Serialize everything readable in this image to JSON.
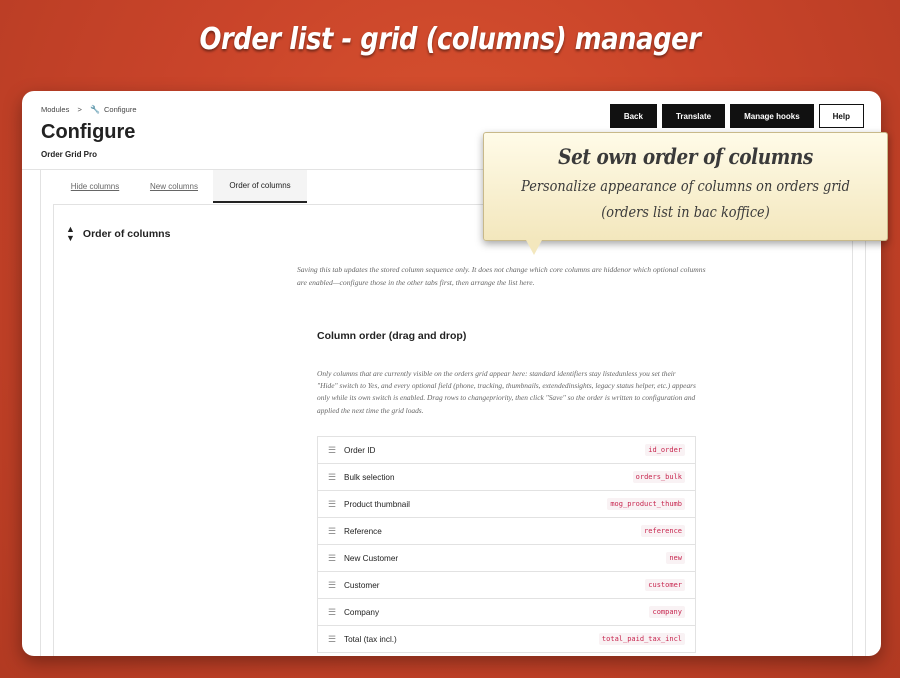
{
  "banner": {
    "title": "Order list - grid (columns) manager"
  },
  "breadcrumb": {
    "parent": "Modules",
    "current": "Configure"
  },
  "header": {
    "title": "Configure",
    "subtitle": "Order Grid Pro"
  },
  "toolbar": {
    "back": "Back",
    "translate": "Translate",
    "manage_hooks": "Manage hooks",
    "help": "Help"
  },
  "tabs": [
    {
      "label": "Hide columns"
    },
    {
      "label": "New columns"
    },
    {
      "label": "Order of columns"
    }
  ],
  "card": {
    "heading": "Order of columns",
    "note": "Saving this tab updates the stored column sequence only. It does not change which core columns are hiddenor which optional columns are enabled—configure those in the other tabs first, then arrange the list here.",
    "subheading": "Column order (drag and drop)",
    "subnote": "Only columns that are currently visible on the orders grid appear here: standard identifiers stay listedunless you set their \"Hide\" switch to Yes, and every optional field (phone, tracking, thumbnails, extendedinsights, legacy status helper, etc.) appears only while its own switch is enabled. Drag rows to changepriority, then click \"Save\" so the order is written to configuration and applied the next time the grid loads."
  },
  "columns": [
    {
      "label": "Order ID",
      "key": "id_order"
    },
    {
      "label": "Bulk selection",
      "key": "orders_bulk"
    },
    {
      "label": "Product thumbnail",
      "key": "mog_product_thumb"
    },
    {
      "label": "Reference",
      "key": "reference"
    },
    {
      "label": "New Customer",
      "key": "new"
    },
    {
      "label": "Customer",
      "key": "customer"
    },
    {
      "label": "Company",
      "key": "company"
    },
    {
      "label": "Total (tax incl.)",
      "key": "total_paid_tax_incl"
    }
  ],
  "callout": {
    "title": "Set own order of columns",
    "line1": "Personalize appearance of columns on orders grid",
    "line2": "(orders list in bac koffice)"
  },
  "icons": {
    "breadcrumb_icon": "wrench-icon",
    "sort_icon": "sort-icon",
    "drag_handle": "drag-handle-icon"
  },
  "colors": {
    "background": "#c9442a",
    "button": "#111111",
    "code_text": "#c7254e"
  }
}
